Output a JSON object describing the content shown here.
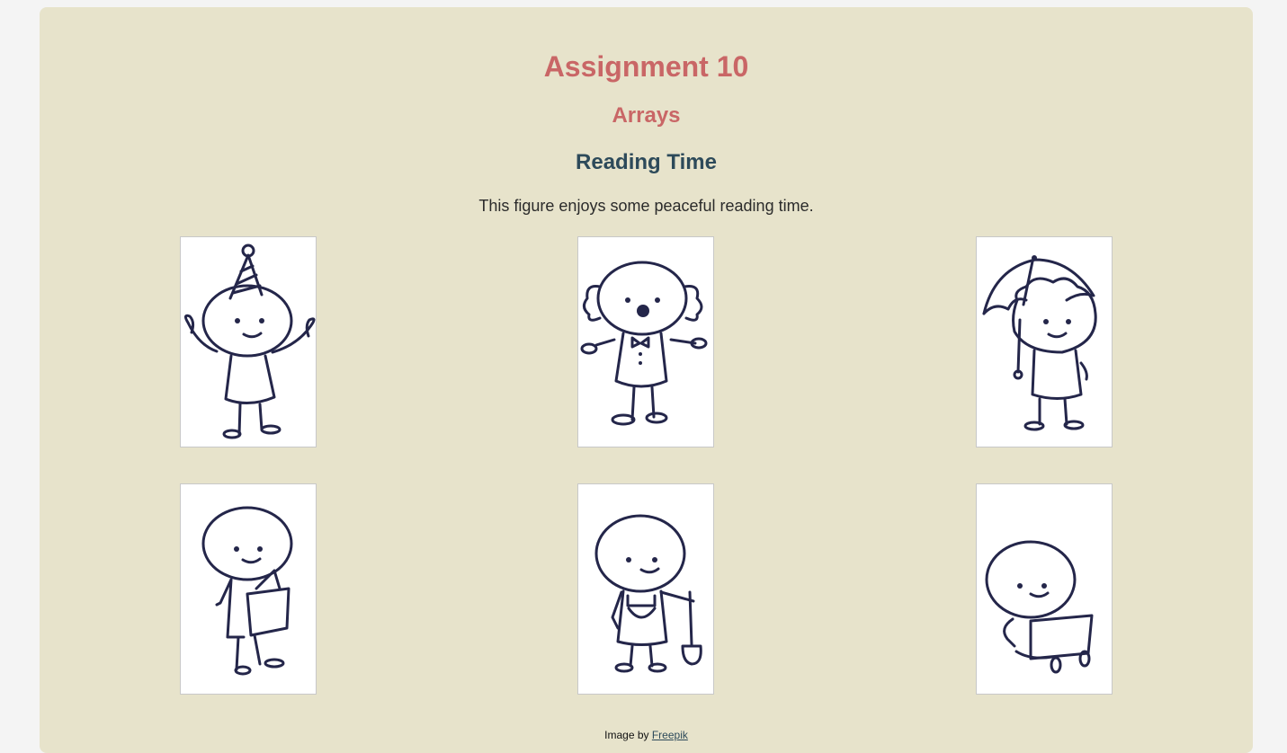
{
  "header": {
    "title": "Assignment 10",
    "subtitle": "Arrays",
    "section_title": "Reading Time",
    "description": "This figure enjoys some peaceful reading time."
  },
  "figures": [
    {
      "icon": "party-hat-figure-icon"
    },
    {
      "icon": "clown-figure-icon"
    },
    {
      "icon": "umbrella-figure-icon"
    },
    {
      "icon": "reading-figure-icon"
    },
    {
      "icon": "gardener-figure-icon"
    },
    {
      "icon": "laptop-figure-icon"
    }
  ],
  "footer": {
    "credit_prefix": "Image by",
    "credit_link": "Freepik"
  },
  "colors": {
    "page_background": "#f4f4f4",
    "panel_background": "#e7e3cb",
    "title": "#c96666",
    "section_title": "#2d4a5a",
    "ink": "#24264a"
  }
}
